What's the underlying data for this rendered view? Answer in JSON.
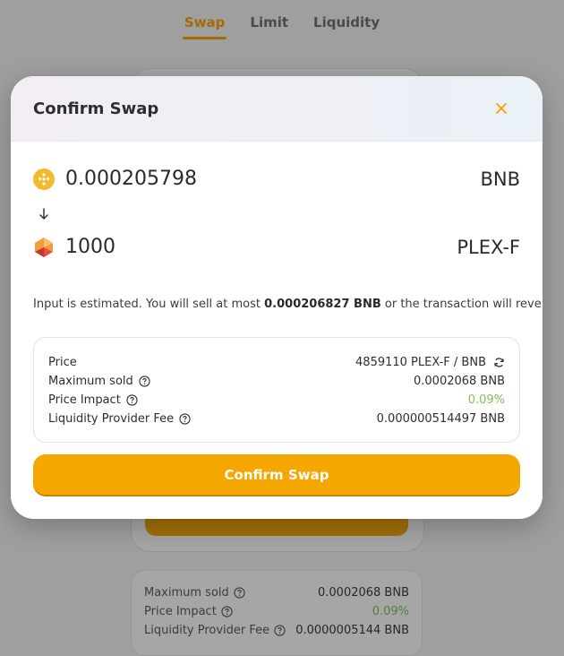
{
  "nav": {
    "tabs": [
      {
        "label": "Swap",
        "active": true
      },
      {
        "label": "Limit",
        "active": false
      },
      {
        "label": "Liquidity",
        "active": false
      }
    ]
  },
  "background_details": {
    "rows": [
      {
        "label": "Maximum sold",
        "value": "0.0002068 BNB"
      },
      {
        "label": "Price Impact",
        "value": "0.09%"
      },
      {
        "label": "Liquidity Provider Fee",
        "value": "0.0000005144 BNB"
      }
    ]
  },
  "modal": {
    "title": "Confirm Swap",
    "close_icon": "close-icon",
    "input_token": {
      "amount": "0.000205798",
      "symbol": "BNB",
      "icon": "bnb-token-icon"
    },
    "output_token": {
      "amount": "1000",
      "symbol": "PLEX-F",
      "icon": "plex-token-icon"
    },
    "estimate": {
      "prefix": "Input is estimated. You will sell at most ",
      "amount": "0.000206827 BNB",
      "suffix": " or the transaction will revert."
    },
    "details": {
      "price": {
        "label": "Price",
        "value": "4859110 PLEX-F / BNB"
      },
      "maximum_sold": {
        "label": "Maximum sold",
        "value": "0.0002068 BNB"
      },
      "price_impact": {
        "label": "Price Impact",
        "value": "0.09%"
      },
      "lp_fee": {
        "label": "Liquidity Provider Fee",
        "value": "0.000000514497 BNB"
      }
    },
    "confirm_button": "Confirm Swap"
  },
  "colors": {
    "accent": "#f5a700",
    "positive": "#7fc05a"
  }
}
